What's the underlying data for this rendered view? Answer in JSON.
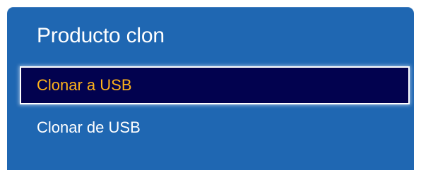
{
  "menu": {
    "title": "Producto clon",
    "items": [
      {
        "label": "Clonar a USB",
        "selected": true
      },
      {
        "label": "Clonar de USB",
        "selected": false
      }
    ]
  },
  "colors": {
    "panel_background": "#1f67b2",
    "selected_background": "#02024f",
    "selected_text": "#ffb21a",
    "text": "#ffffff"
  }
}
